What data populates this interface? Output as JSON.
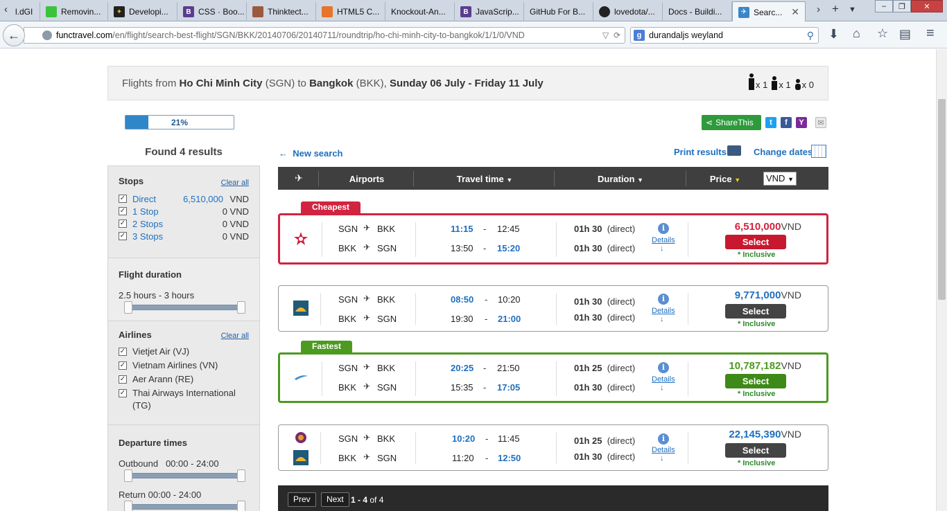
{
  "browser": {
    "tabs": [
      {
        "label": "l.dGI",
        "fav": ""
      },
      {
        "label": "Removin...",
        "fav": ""
      },
      {
        "label": "Developi...",
        "fav": ""
      },
      {
        "label": "CSS · Boo...",
        "fav": "B"
      },
      {
        "label": "Thinktect...",
        "fav": ""
      },
      {
        "label": "HTML5 C...",
        "fav": ""
      },
      {
        "label": "Knockout-An...",
        "fav": ""
      },
      {
        "label": "JavaScrip...",
        "fav": "B"
      },
      {
        "label": "GitHub For B...",
        "fav": ""
      },
      {
        "label": "lovedota/...",
        "fav": ""
      },
      {
        "label": "Docs - Buildi...",
        "fav": ""
      },
      {
        "label": "Searc...",
        "fav": ""
      }
    ],
    "url_host": "functravel.com",
    "url_path": "/en/flight/search-best-flight/SGN/BKK/20140706/20140711/roundtrip/ho-chi-minh-city-to-bangkok/1/1/0/VND",
    "search_engine": "g",
    "search_value": "durandaljs weyland"
  },
  "header": {
    "prefix": "Flights from",
    "from_city": "Ho Chi Minh City",
    "from_code": "(SGN) to",
    "to_city": "Bangkok",
    "to_code": "(BKK),",
    "dates": "Sunday 06 July - Friday 11 July",
    "adults": "x 1",
    "children": "x 1",
    "infants": "x 0"
  },
  "progress": {
    "label": "21%",
    "value": 0.21
  },
  "found": "Found 4 results",
  "filters": {
    "clear_all": "Clear all",
    "stops_title": "Stops",
    "stops": [
      {
        "label": "Direct",
        "value": "6,510,000",
        "currency": "VND"
      },
      {
        "label": "1 Stop",
        "value": "0",
        "currency": "VND"
      },
      {
        "label": "2 Stops",
        "value": "0",
        "currency": "VND"
      },
      {
        "label": "3 Stops",
        "value": "0",
        "currency": "VND"
      }
    ],
    "duration_title": "Flight duration",
    "duration_range": "2.5 hours - 3 hours",
    "airlines_title": "Airlines",
    "airlines": [
      "Vietjet Air (VJ)",
      "Vietnam Airlines (VN)",
      "Aer Arann (RE)",
      "Thai Airways International (TG)"
    ],
    "departure_title": "Departure times",
    "outbound_label": "Outbound",
    "outbound_range": "00:00 - 24:00",
    "return_label": "Return",
    "return_range": "00:00 - 24:00"
  },
  "actions": {
    "share": "ShareThis",
    "new_search": "New search",
    "print_results": "Print results",
    "change_dates": "Change dates"
  },
  "table": {
    "col_airports": "Airports",
    "col_travel": "Travel time",
    "col_duration": "Duration",
    "col_price": "Price",
    "currency": "VND"
  },
  "badges": {
    "cheapest": "Cheapest",
    "fastest": "Fastest"
  },
  "results": [
    {
      "out": {
        "from": "SGN",
        "to": "BKK",
        "dep": "11:15",
        "arr": "12:45",
        "dur": "01h 30",
        "type": "(direct)"
      },
      "ret": {
        "from": "BKK",
        "to": "SGN",
        "dep": "13:50",
        "arr": "15:20",
        "dur": "01h 30",
        "type": "(direct)"
      },
      "price": "6,510,000",
      "currency": "VND",
      "select": "Select",
      "inclusive": "* Inclusive",
      "details": "Details"
    },
    {
      "out": {
        "from": "SGN",
        "to": "BKK",
        "dep": "08:50",
        "arr": "10:20",
        "dur": "01h 30",
        "type": "(direct)"
      },
      "ret": {
        "from": "BKK",
        "to": "SGN",
        "dep": "19:30",
        "arr": "21:00",
        "dur": "01h 30",
        "type": "(direct)"
      },
      "price": "9,771,000",
      "currency": "VND",
      "select": "Select",
      "inclusive": "* Inclusive",
      "details": "Details"
    },
    {
      "out": {
        "from": "SGN",
        "to": "BKK",
        "dep": "20:25",
        "arr": "21:50",
        "dur": "01h 25",
        "type": "(direct)"
      },
      "ret": {
        "from": "BKK",
        "to": "SGN",
        "dep": "15:35",
        "arr": "17:05",
        "dur": "01h 30",
        "type": "(direct)"
      },
      "price": "10,787,182",
      "currency": "VND",
      "select": "Select",
      "inclusive": "* Inclusive",
      "details": "Details"
    },
    {
      "out": {
        "from": "SGN",
        "to": "BKK",
        "dep": "10:20",
        "arr": "11:45",
        "dur": "01h 25",
        "type": "(direct)"
      },
      "ret": {
        "from": "BKK",
        "to": "SGN",
        "dep": "11:20",
        "arr": "12:50",
        "dur": "01h 30",
        "type": "(direct)"
      },
      "price": "22,145,390",
      "currency": "VND",
      "select": "Select",
      "inclusive": "* Inclusive",
      "details": "Details"
    }
  ],
  "pager": {
    "prev": "Prev",
    "next": "Next",
    "range": "1 - 4",
    "of": "of 4"
  },
  "colors": {
    "cheapest": "#d22340",
    "fastest": "#4c9a20",
    "link": "#1f6fbf",
    "header_dark": "#3f3f3f"
  }
}
